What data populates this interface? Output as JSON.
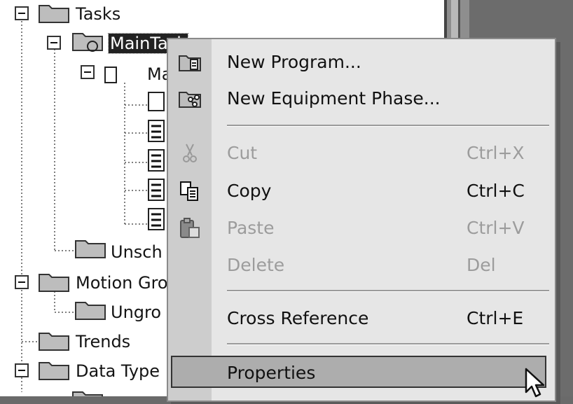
{
  "tree": {
    "tasks": "Tasks",
    "main_task": "MainTask",
    "main_program": "Ma",
    "unscheduled": "Unsch",
    "motion_groups": "Motion Gro",
    "ungrouped": "Ungro",
    "trends": "Trends",
    "data_types": "Data Type"
  },
  "menu": {
    "items": [
      {
        "label": "New Program...",
        "shortcut": "",
        "icon": "new-program-icon"
      },
      {
        "label": "New Equipment Phase...",
        "shortcut": "",
        "icon": "new-phase-icon"
      },
      {
        "label": "Cut",
        "shortcut": "Ctrl+X",
        "icon": "cut-icon"
      },
      {
        "label": "Copy",
        "shortcut": "Ctrl+C",
        "icon": "copy-icon"
      },
      {
        "label": "Paste",
        "shortcut": "Ctrl+V",
        "icon": "paste-icon"
      },
      {
        "label": "Delete",
        "shortcut": "Del",
        "icon": ""
      },
      {
        "label": "Cross Reference",
        "shortcut": "Ctrl+E",
        "icon": ""
      },
      {
        "label": "Properties",
        "shortcut": "",
        "icon": ""
      }
    ]
  }
}
